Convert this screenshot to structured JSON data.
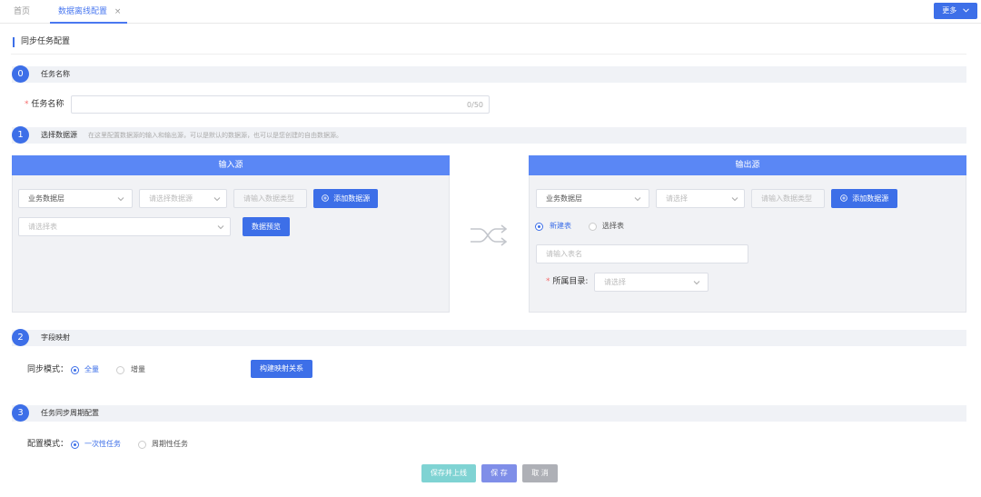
{
  "tabs": {
    "home": "首页",
    "active": "数据离线配置",
    "close": "×",
    "more": "更多"
  },
  "page_title": "同步任务配置",
  "sections": [
    {
      "step": "0",
      "title": "任务名称",
      "hint": ""
    },
    {
      "step": "1",
      "title": "选择数据源",
      "hint": "在这里配置数据源的输入和输出源，可以是默认的数据源，也可以是您创建的自由数据源。"
    },
    {
      "step": "2",
      "title": "字段映射",
      "hint": ""
    },
    {
      "step": "3",
      "title": "任务同步周期配置",
      "hint": ""
    }
  ],
  "task_name": {
    "required_mark": "*",
    "label": "任务名称",
    "value": "",
    "counter": "0/50"
  },
  "input_source": {
    "header": "输入源",
    "layer_value": "业务数据层",
    "datasource_placeholder": "请选择数据源",
    "type_placeholder": "请输入数据类型",
    "add_button": "添加数据源",
    "table_placeholder": "请选择表",
    "preview_button": "数据预览"
  },
  "output_source": {
    "header": "输出源",
    "layer_value": "业务数据层",
    "select_placeholder": "请选择",
    "type_placeholder": "请输入数据类型",
    "add_button": "添加数据源",
    "radio_new": "新建表",
    "radio_select": "选择表",
    "table_name_placeholder": "请输入表名",
    "dir_required_mark": "*",
    "dir_label": "所属目录:",
    "dir_placeholder": "请选择"
  },
  "mapping": {
    "label": "同步模式：",
    "option_full": "全量",
    "option_incremental": "增量",
    "build_button": "构建映射关系"
  },
  "schedule": {
    "label": "配置模式：",
    "option_once": "一次性任务",
    "option_periodic": "周期性任务"
  },
  "footer": {
    "save_online": "保存并上线",
    "save": "保 存",
    "cancel": "取 消"
  },
  "colors": {
    "primary": "#3d6fe8",
    "panel_header": "#5a87f5",
    "save_online": "#7fd3d3",
    "save": "#7f8ee8",
    "cancel": "#aeb0b6"
  }
}
